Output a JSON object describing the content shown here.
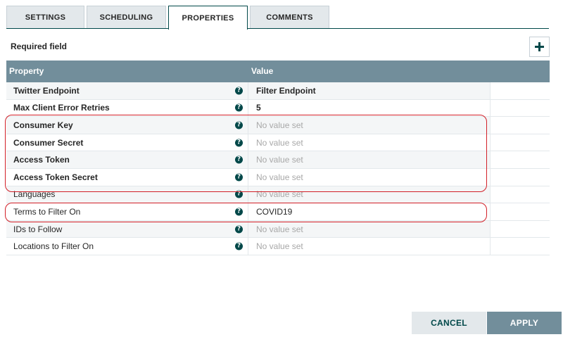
{
  "tabs": [
    {
      "label": "SETTINGS"
    },
    {
      "label": "SCHEDULING"
    },
    {
      "label": "PROPERTIES"
    },
    {
      "label": "COMMENTS"
    }
  ],
  "active_tab": "PROPERTIES",
  "required_label": "Required field",
  "add_button_icon": "plus-icon",
  "table": {
    "headers": {
      "property": "Property",
      "value": "Value"
    },
    "rows": [
      {
        "property": "Twitter Endpoint",
        "value": "Filter Endpoint"
      },
      {
        "property": "Max Client Error Retries",
        "value": "5"
      },
      {
        "property": "Consumer Key",
        "value": "No value set"
      },
      {
        "property": "Consumer Secret",
        "value": "No value set"
      },
      {
        "property": "Access Token",
        "value": "No value set"
      },
      {
        "property": "Access Token Secret",
        "value": "No value set"
      },
      {
        "property": "Languages",
        "value": "No value set"
      },
      {
        "property": "Terms to Filter On",
        "value": "COVID19"
      },
      {
        "property": "IDs to Follow",
        "value": "No value set"
      },
      {
        "property": "Locations to Filter On",
        "value": "No value set"
      }
    ]
  },
  "help_icon_glyph": "?",
  "buttons": {
    "cancel": "CANCEL",
    "apply": "APPLY"
  },
  "colors": {
    "primary": "#004849",
    "header": "#728e9b",
    "highlight": "#d21f27"
  }
}
